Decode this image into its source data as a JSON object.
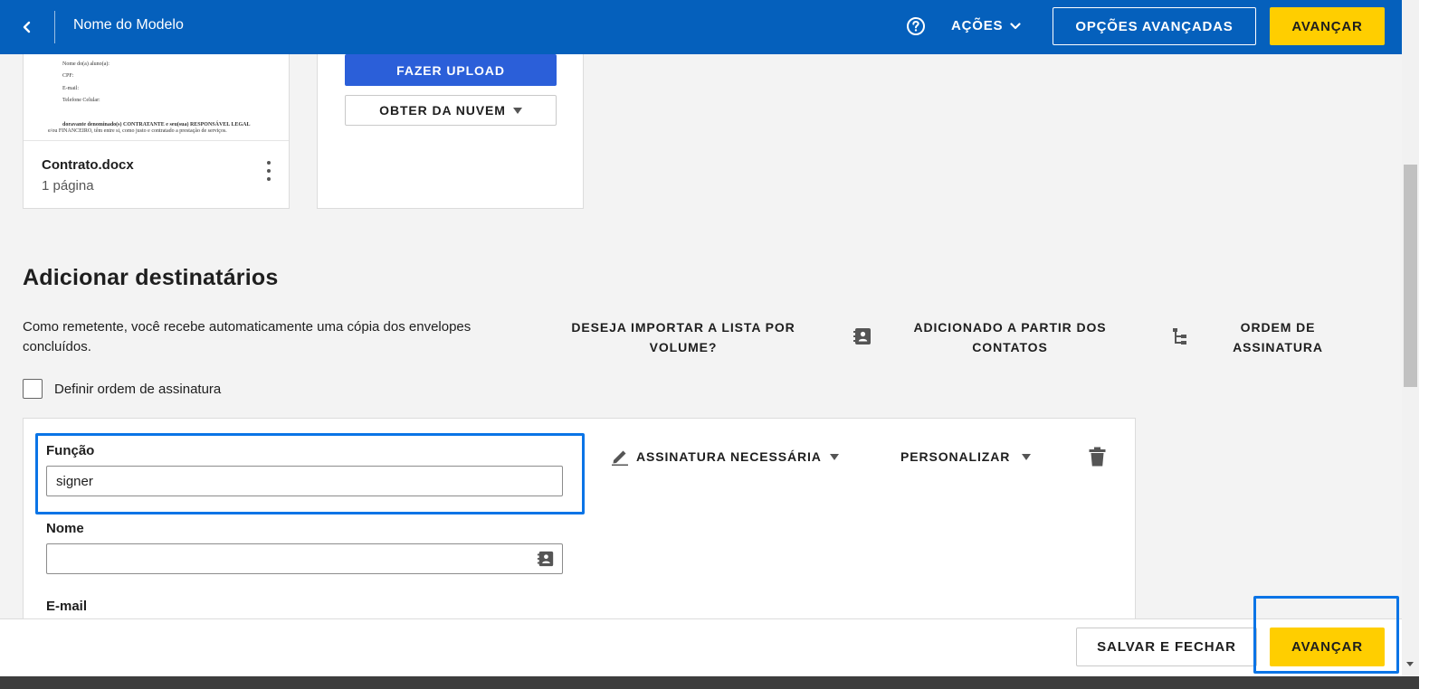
{
  "header": {
    "title": "Nome do Modelo",
    "actions_label": "AÇÕES",
    "advanced_options_label": "OPÇÕES AVANÇADAS",
    "next_label": "AVANÇAR"
  },
  "document": {
    "file_name": "Contrato.docx",
    "pages": "1 página",
    "thumbnail_lines": [
      "Nome do(a) aluno(a):",
      "CPF:",
      "E-mail:",
      "Telefone Celular:",
      "doravante denominado(s) CONTRATANTE e seu(sua) RESPONSÁVEL LEGAL",
      "e/ou FINANCEIRO, têm entre si, como justo e contratado a prestação de serviços."
    ]
  },
  "upload": {
    "upload_label": "FAZER UPLOAD",
    "cloud_label": "OBTER DA NUVEM"
  },
  "recipients": {
    "title": "Adicionar destinatários",
    "description": "Como remetente, você recebe automaticamente uma cópia dos envelopes concluídos.",
    "import_bulk": "DESEJA IMPORTAR A LISTA POR VOLUME?",
    "add_from_contacts": "ADICIONADO A PARTIR DOS CONTATOS",
    "signing_order": "ORDEM DE ASSINATURA",
    "set_signing_order_label": "Definir ordem de assinatura",
    "recipient": {
      "role_label": "Função",
      "role_value": "signer",
      "name_label": "Nome",
      "name_value": "",
      "email_label": "E-mail",
      "action": "ASSINATURA NECESSÁRIA",
      "customize": "PERSONALIZAR"
    }
  },
  "footer": {
    "save_close_label": "SALVAR E FECHAR",
    "next_label": "AVANÇAR"
  },
  "colors": {
    "header_bg": "#0560bc",
    "accent_yellow": "#ffce00",
    "upload_blue": "#2b5fd9",
    "highlight_blue": "#0a74e6"
  }
}
